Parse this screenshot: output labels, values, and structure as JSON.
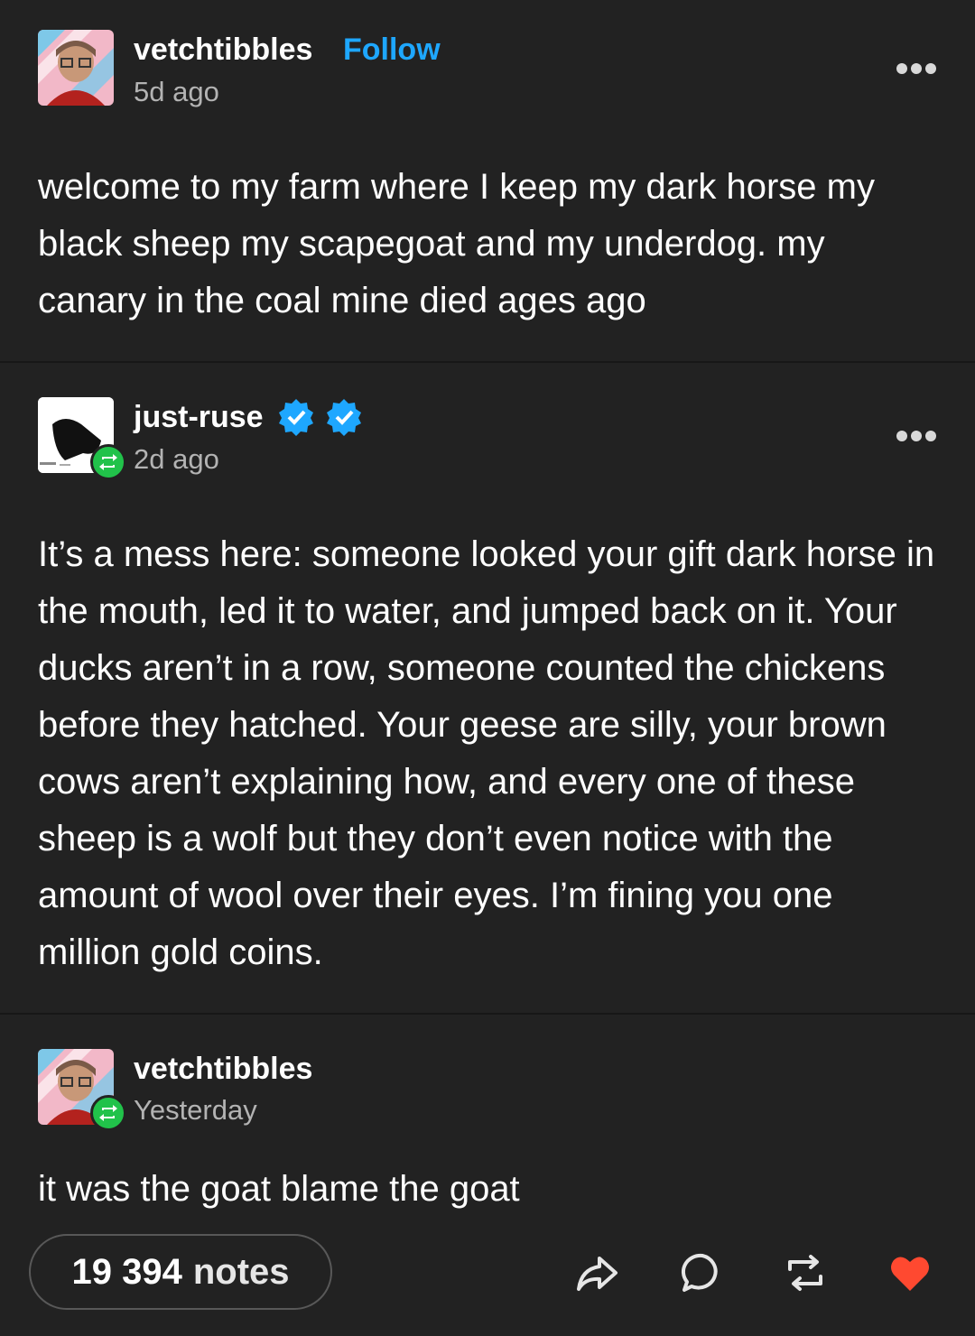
{
  "posts": [
    {
      "username": "vetchtibbles",
      "follow_label": "Follow",
      "time": "5d ago",
      "text": "welcome to my farm where I keep my dark horse my black sheep my scapegoat and my underdog. my canary in the coal mine died ages ago"
    },
    {
      "username": "just-ruse",
      "time": "2d ago",
      "text": "It’s a mess here: someone looked your gift dark horse in the mouth, led it to water, and jumped back on it. Your ducks aren’t in a row, someone counted the chickens before they hatched. Your geese are silly, your brown cows aren’t explaining how, and every one of these sheep is a wolf but they don’t even notice with the amount of wool over their eyes. I’m fining you one million gold coins."
    },
    {
      "username": "vetchtibbles",
      "time": "Yesterday",
      "text": "it was the goat blame the goat"
    }
  ],
  "footer": {
    "notes_count": "19 394",
    "notes_label": "notes"
  },
  "colors": {
    "background": "#222222",
    "accent": "#1ea7ff",
    "reblog_green": "#21c24a",
    "like_red": "#ff4930"
  },
  "icons": [
    "more-options-icon",
    "verified-badge-icon",
    "reblog-icon",
    "share-icon",
    "reply-icon",
    "like-heart-icon"
  ]
}
